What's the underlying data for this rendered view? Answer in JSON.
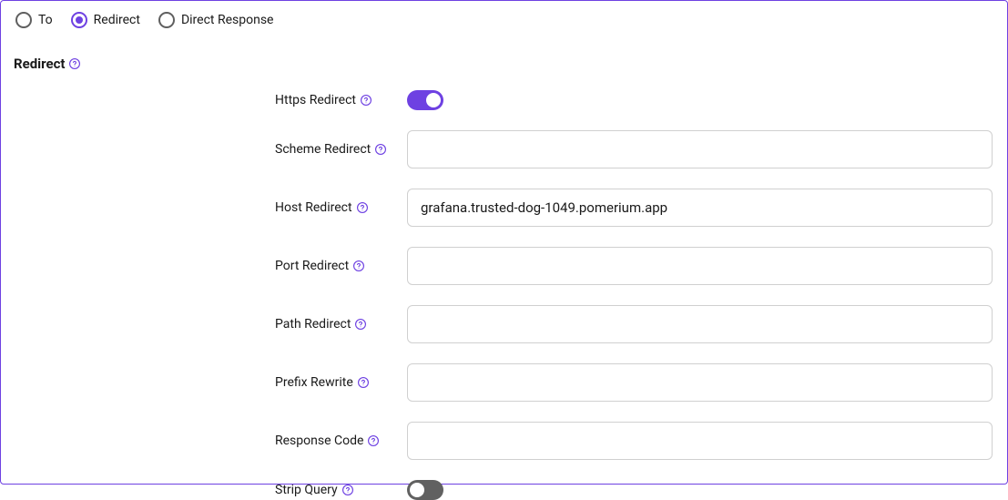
{
  "radios": {
    "to": "To",
    "redirect": "Redirect",
    "direct_response": "Direct Response"
  },
  "section": {
    "title": "Redirect"
  },
  "fields": {
    "https_redirect": {
      "label": "Https Redirect",
      "on": true
    },
    "scheme_redirect": {
      "label": "Scheme Redirect",
      "value": ""
    },
    "host_redirect": {
      "label": "Host Redirect",
      "value": "grafana.trusted-dog-1049.pomerium.app"
    },
    "port_redirect": {
      "label": "Port Redirect",
      "value": ""
    },
    "path_redirect": {
      "label": "Path Redirect",
      "value": ""
    },
    "prefix_rewrite": {
      "label": "Prefix Rewrite",
      "value": ""
    },
    "response_code": {
      "label": "Response Code",
      "value": ""
    },
    "strip_query": {
      "label": "Strip Query",
      "on": false
    }
  }
}
